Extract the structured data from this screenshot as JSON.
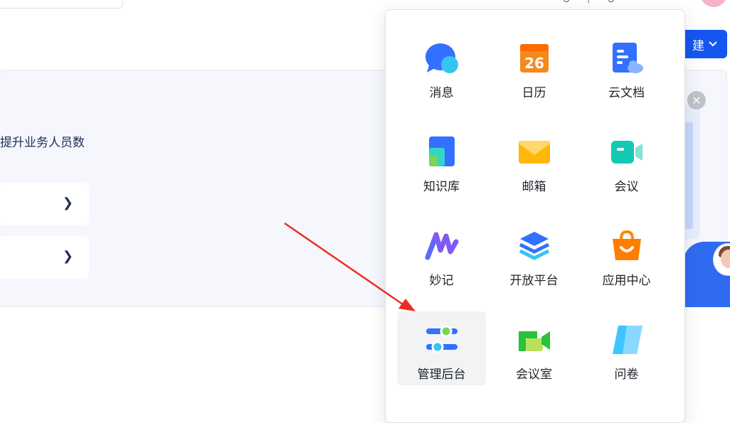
{
  "header": {
    "create_button_label": "建",
    "top_icons": [
      "refresh-icon",
      "help-icon",
      "more-icon"
    ]
  },
  "banner": {
    "text": "提升业务人员数"
  },
  "app_panel": {
    "apps": [
      {
        "label": "消息",
        "icon": "message-icon"
      },
      {
        "label": "日历",
        "icon": "calendar-icon",
        "badge": "26"
      },
      {
        "label": "云文档",
        "icon": "cloud-doc-icon"
      },
      {
        "label": "知识库",
        "icon": "wiki-icon"
      },
      {
        "label": "邮箱",
        "icon": "mail-icon"
      },
      {
        "label": "会议",
        "icon": "video-meeting-icon"
      },
      {
        "label": "妙记",
        "icon": "minutes-icon"
      },
      {
        "label": "开放平台",
        "icon": "open-platform-icon"
      },
      {
        "label": "应用中心",
        "icon": "app-center-icon"
      },
      {
        "label": "管理后台",
        "icon": "admin-console-icon"
      },
      {
        "label": "会议室",
        "icon": "meeting-room-icon"
      },
      {
        "label": "问卷",
        "icon": "survey-icon"
      }
    ]
  },
  "colors": {
    "accent_blue": "#1456f0",
    "annotation_arrow": "#ee2b24",
    "hover_bg": "#f2f3f5"
  }
}
